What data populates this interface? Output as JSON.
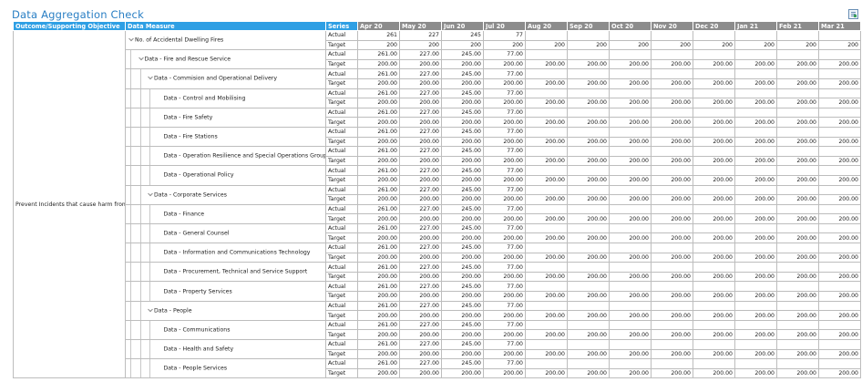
{
  "page": {
    "title": "Data Aggregation Check"
  },
  "icons": {
    "export": "export-excel-icon"
  },
  "table": {
    "columns": {
      "outcome": "Outcome/Supporting Objective",
      "measure": "Data Measure",
      "series": "Series",
      "months": [
        "Apr 20",
        "May 20",
        "Jun 20",
        "Jul 20",
        "Aug 20",
        "Sep 20",
        "Oct 20",
        "Nov 20",
        "Dec 20",
        "Jan 21",
        "Feb 21",
        "Mar 21"
      ]
    },
    "outcome_text": "Prevent Incidents that cause harm from happening.",
    "series_labels": {
      "actual": "Actual",
      "target": "Target"
    },
    "measures": [
      {
        "label": "No. of Accidental Dwelling Fires",
        "level": 0,
        "toggle": true,
        "actual": [
          "261",
          "227",
          "245",
          "77",
          "",
          "",
          "",
          "",
          "",
          "",
          "",
          ""
        ],
        "target": [
          "200",
          "200",
          "200",
          "200",
          "200",
          "200",
          "200",
          "200",
          "200",
          "200",
          "200",
          "200"
        ]
      },
      {
        "label": "Data - Fire and Rescue Service",
        "level": 1,
        "toggle": true,
        "actual": [
          "261.00",
          "227.00",
          "245.00",
          "77.00",
          "",
          "",
          "",
          "",
          "",
          "",
          "",
          ""
        ],
        "target": [
          "200.00",
          "200.00",
          "200.00",
          "200.00",
          "200.00",
          "200.00",
          "200.00",
          "200.00",
          "200.00",
          "200.00",
          "200.00",
          "200.00"
        ]
      },
      {
        "label": "Data - Commision and Operational Delivery",
        "level": 2,
        "toggle": true,
        "actual": [
          "261.00",
          "227.00",
          "245.00",
          "77.00",
          "",
          "",
          "",
          "",
          "",
          "",
          "",
          ""
        ],
        "target": [
          "200.00",
          "200.00",
          "200.00",
          "200.00",
          "200.00",
          "200.00",
          "200.00",
          "200.00",
          "200.00",
          "200.00",
          "200.00",
          "200.00"
        ]
      },
      {
        "label": "Data - Control and Mobilising",
        "level": 3,
        "toggle": false,
        "actual": [
          "261.00",
          "227.00",
          "245.00",
          "77.00",
          "",
          "",
          "",
          "",
          "",
          "",
          "",
          ""
        ],
        "target": [
          "200.00",
          "200.00",
          "200.00",
          "200.00",
          "200.00",
          "200.00",
          "200.00",
          "200.00",
          "200.00",
          "200.00",
          "200.00",
          "200.00"
        ]
      },
      {
        "label": "Data - Fire Safety",
        "level": 3,
        "toggle": false,
        "actual": [
          "261.00",
          "227.00",
          "245.00",
          "77.00",
          "",
          "",
          "",
          "",
          "",
          "",
          "",
          ""
        ],
        "target": [
          "200.00",
          "200.00",
          "200.00",
          "200.00",
          "200.00",
          "200.00",
          "200.00",
          "200.00",
          "200.00",
          "200.00",
          "200.00",
          "200.00"
        ]
      },
      {
        "label": "Data - Fire Stations",
        "level": 3,
        "toggle": false,
        "actual": [
          "261.00",
          "227.00",
          "245.00",
          "77.00",
          "",
          "",
          "",
          "",
          "",
          "",
          "",
          ""
        ],
        "target": [
          "200.00",
          "200.00",
          "200.00",
          "200.00",
          "200.00",
          "200.00",
          "200.00",
          "200.00",
          "200.00",
          "200.00",
          "200.00",
          "200.00"
        ]
      },
      {
        "label": "Data - Operation Resilience and Special Operations Group",
        "level": 3,
        "toggle": false,
        "actual": [
          "261.00",
          "227.00",
          "245.00",
          "77.00",
          "",
          "",
          "",
          "",
          "",
          "",
          "",
          ""
        ],
        "target": [
          "200.00",
          "200.00",
          "200.00",
          "200.00",
          "200.00",
          "200.00",
          "200.00",
          "200.00",
          "200.00",
          "200.00",
          "200.00",
          "200.00"
        ]
      },
      {
        "label": "Data - Operational Policy",
        "level": 3,
        "toggle": false,
        "actual": [
          "261.00",
          "227.00",
          "245.00",
          "77.00",
          "",
          "",
          "",
          "",
          "",
          "",
          "",
          ""
        ],
        "target": [
          "200.00",
          "200.00",
          "200.00",
          "200.00",
          "200.00",
          "200.00",
          "200.00",
          "200.00",
          "200.00",
          "200.00",
          "200.00",
          "200.00"
        ]
      },
      {
        "label": "Data - Corporate Services",
        "level": 2,
        "toggle": true,
        "actual": [
          "261.00",
          "227.00",
          "245.00",
          "77.00",
          "",
          "",
          "",
          "",
          "",
          "",
          "",
          ""
        ],
        "target": [
          "200.00",
          "200.00",
          "200.00",
          "200.00",
          "200.00",
          "200.00",
          "200.00",
          "200.00",
          "200.00",
          "200.00",
          "200.00",
          "200.00"
        ]
      },
      {
        "label": "Data - Finance",
        "level": 3,
        "toggle": false,
        "actual": [
          "261.00",
          "227.00",
          "245.00",
          "77.00",
          "",
          "",
          "",
          "",
          "",
          "",
          "",
          ""
        ],
        "target": [
          "200.00",
          "200.00",
          "200.00",
          "200.00",
          "200.00",
          "200.00",
          "200.00",
          "200.00",
          "200.00",
          "200.00",
          "200.00",
          "200.00"
        ]
      },
      {
        "label": "Data - General Counsel",
        "level": 3,
        "toggle": false,
        "actual": [
          "261.00",
          "227.00",
          "245.00",
          "77.00",
          "",
          "",
          "",
          "",
          "",
          "",
          "",
          ""
        ],
        "target": [
          "200.00",
          "200.00",
          "200.00",
          "200.00",
          "200.00",
          "200.00",
          "200.00",
          "200.00",
          "200.00",
          "200.00",
          "200.00",
          "200.00"
        ]
      },
      {
        "label": "Data - Information and Communications Technology",
        "level": 3,
        "toggle": false,
        "actual": [
          "261.00",
          "227.00",
          "245.00",
          "77.00",
          "",
          "",
          "",
          "",
          "",
          "",
          "",
          ""
        ],
        "target": [
          "200.00",
          "200.00",
          "200.00",
          "200.00",
          "200.00",
          "200.00",
          "200.00",
          "200.00",
          "200.00",
          "200.00",
          "200.00",
          "200.00"
        ]
      },
      {
        "label": "Data - Procurement, Technical and Service Support",
        "level": 3,
        "toggle": false,
        "actual": [
          "261.00",
          "227.00",
          "245.00",
          "77.00",
          "",
          "",
          "",
          "",
          "",
          "",
          "",
          ""
        ],
        "target": [
          "200.00",
          "200.00",
          "200.00",
          "200.00",
          "200.00",
          "200.00",
          "200.00",
          "200.00",
          "200.00",
          "200.00",
          "200.00",
          "200.00"
        ]
      },
      {
        "label": "Data - Property Services",
        "level": 3,
        "toggle": false,
        "actual": [
          "261.00",
          "227.00",
          "245.00",
          "77.00",
          "",
          "",
          "",
          "",
          "",
          "",
          "",
          ""
        ],
        "target": [
          "200.00",
          "200.00",
          "200.00",
          "200.00",
          "200.00",
          "200.00",
          "200.00",
          "200.00",
          "200.00",
          "200.00",
          "200.00",
          "200.00"
        ]
      },
      {
        "label": "Data - People",
        "level": 2,
        "toggle": true,
        "actual": [
          "261.00",
          "227.00",
          "245.00",
          "77.00",
          "",
          "",
          "",
          "",
          "",
          "",
          "",
          ""
        ],
        "target": [
          "200.00",
          "200.00",
          "200.00",
          "200.00",
          "200.00",
          "200.00",
          "200.00",
          "200.00",
          "200.00",
          "200.00",
          "200.00",
          "200.00"
        ]
      },
      {
        "label": "Data - Communications",
        "level": 3,
        "toggle": false,
        "actual": [
          "261.00",
          "227.00",
          "245.00",
          "77.00",
          "",
          "",
          "",
          "",
          "",
          "",
          "",
          ""
        ],
        "target": [
          "200.00",
          "200.00",
          "200.00",
          "200.00",
          "200.00",
          "200.00",
          "200.00",
          "200.00",
          "200.00",
          "200.00",
          "200.00",
          "200.00"
        ]
      },
      {
        "label": "Data - Health and Safety",
        "level": 3,
        "toggle": false,
        "actual": [
          "261.00",
          "227.00",
          "245.00",
          "77.00",
          "",
          "",
          "",
          "",
          "",
          "",
          "",
          ""
        ],
        "target": [
          "200.00",
          "200.00",
          "200.00",
          "200.00",
          "200.00",
          "200.00",
          "200.00",
          "200.00",
          "200.00",
          "200.00",
          "200.00",
          "200.00"
        ]
      },
      {
        "label": "Data - People Services",
        "level": 3,
        "toggle": false,
        "actual": [
          "261.00",
          "227.00",
          "245.00",
          "77.00",
          "",
          "",
          "",
          "",
          "",
          "",
          "",
          ""
        ],
        "target": [
          "200.00",
          "200.00",
          "200.00",
          "200.00",
          "200.00",
          "200.00",
          "200.00",
          "200.00",
          "200.00",
          "200.00",
          "200.00",
          "200.00"
        ]
      }
    ]
  }
}
